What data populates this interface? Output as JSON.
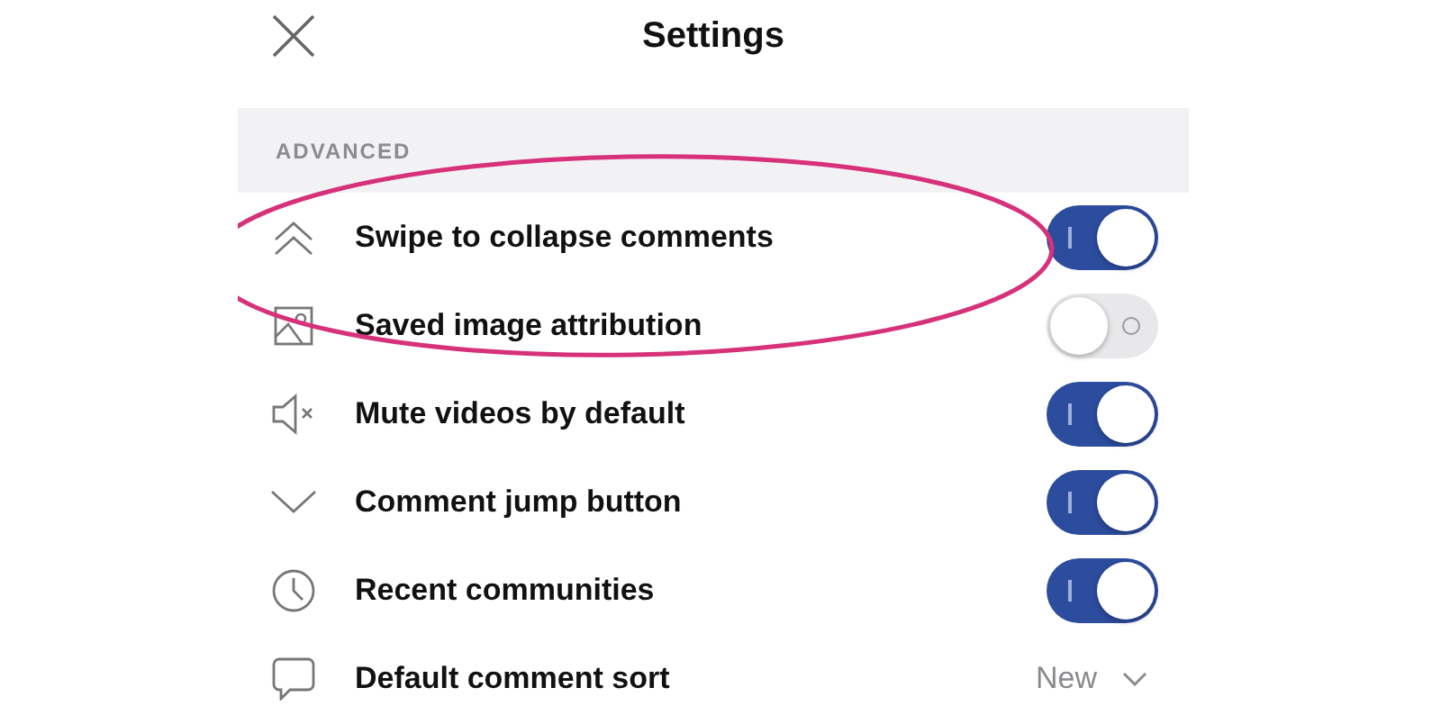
{
  "header": {
    "title": "Settings"
  },
  "section": {
    "title": "ADVANCED"
  },
  "rows": [
    {
      "kind": "toggle",
      "label": "Swipe to collapse comments",
      "on": true
    },
    {
      "kind": "toggle",
      "label": "Saved image attribution",
      "on": false
    },
    {
      "kind": "toggle",
      "label": "Mute videos by default",
      "on": true
    },
    {
      "kind": "toggle",
      "label": "Comment jump button",
      "on": true
    },
    {
      "kind": "toggle",
      "label": "Recent communities",
      "on": true
    },
    {
      "kind": "select",
      "label": "Default comment sort",
      "value": "New"
    }
  ],
  "annotation": {
    "kind": "ellipse",
    "color": "#d6317a"
  }
}
